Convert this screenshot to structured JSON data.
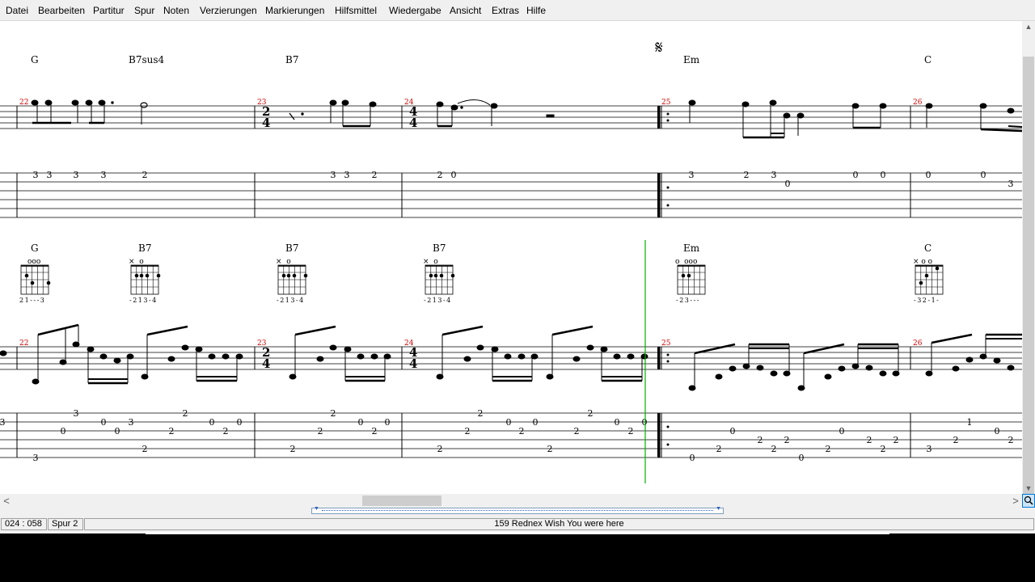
{
  "menu": {
    "items": [
      "Datei",
      "Bearbeiten",
      "Partitur",
      "Spur",
      "Noten",
      "Verzierungen",
      "Markierungen",
      "Hilfsmittel",
      "Wiedergabe",
      "Ansicht",
      "Extras",
      "Hilfe"
    ]
  },
  "score": {
    "segno": "𝄋",
    "system1": {
      "chords": [
        {
          "label": "G"
        },
        {
          "label": "B7sus4"
        },
        {
          "label": "B7"
        },
        {
          "label": "Em"
        },
        {
          "label": "C"
        }
      ],
      "measure_numbers": [
        "22",
        "23",
        "24",
        "25",
        "26"
      ],
      "time_signatures": [
        {
          "top": "2",
          "bottom": "4"
        },
        {
          "top": "4",
          "bottom": "4"
        }
      ],
      "tab_numbers": [
        "3",
        "3",
        "3",
        "3",
        "2",
        "3",
        "3",
        "2",
        "2",
        "0",
        "3",
        "2",
        "3",
        "0",
        "0",
        "0",
        "0",
        "0",
        "3"
      ]
    },
    "system2": {
      "chords": [
        {
          "label": "G",
          "fingering": "21---3",
          "top": "ooo"
        },
        {
          "label": "B7",
          "fingering": "-213-4",
          "top": "×  o"
        },
        {
          "label": "B7",
          "fingering": "-213-4",
          "top": "×  o"
        },
        {
          "label": "B7",
          "fingering": "-213-4",
          "top": "×  o"
        },
        {
          "label": "Em",
          "fingering": "-23---",
          "top": "o  ooo"
        },
        {
          "label": "C",
          "fingering": "-32-1-",
          "top": "× o o"
        }
      ],
      "measure_numbers": [
        "22",
        "23",
        "24",
        "25",
        "26"
      ],
      "time_signatures": [
        {
          "top": "2",
          "bottom": "4"
        },
        {
          "top": "4",
          "bottom": "4"
        }
      ],
      "tab_numbers": [
        "3",
        "3",
        "0",
        "3",
        "0",
        "0",
        "2",
        "2",
        "2",
        "0",
        "0",
        "2",
        "3",
        "2",
        "2",
        "0",
        "0",
        "2",
        "0",
        "2",
        "0",
        "2",
        "2",
        "0",
        "2",
        "2",
        "0",
        "0",
        "2",
        "2",
        "0",
        "2",
        "2",
        "2",
        "0",
        "2",
        "1",
        "3",
        "2",
        "0",
        "2"
      ]
    }
  },
  "scrollbars": {
    "vertical_up": "▲",
    "vertical_down": "▼",
    "horizontal_left": "<",
    "horizontal_right": ">",
    "zoom_icon": "🔍"
  },
  "status": {
    "position": "024 : 058",
    "track": "Spur 2",
    "title": "159  Rednex  Wish You  were here"
  },
  "colors": {
    "measure_number": "#d00000",
    "playback_cursor": "#00b000"
  }
}
